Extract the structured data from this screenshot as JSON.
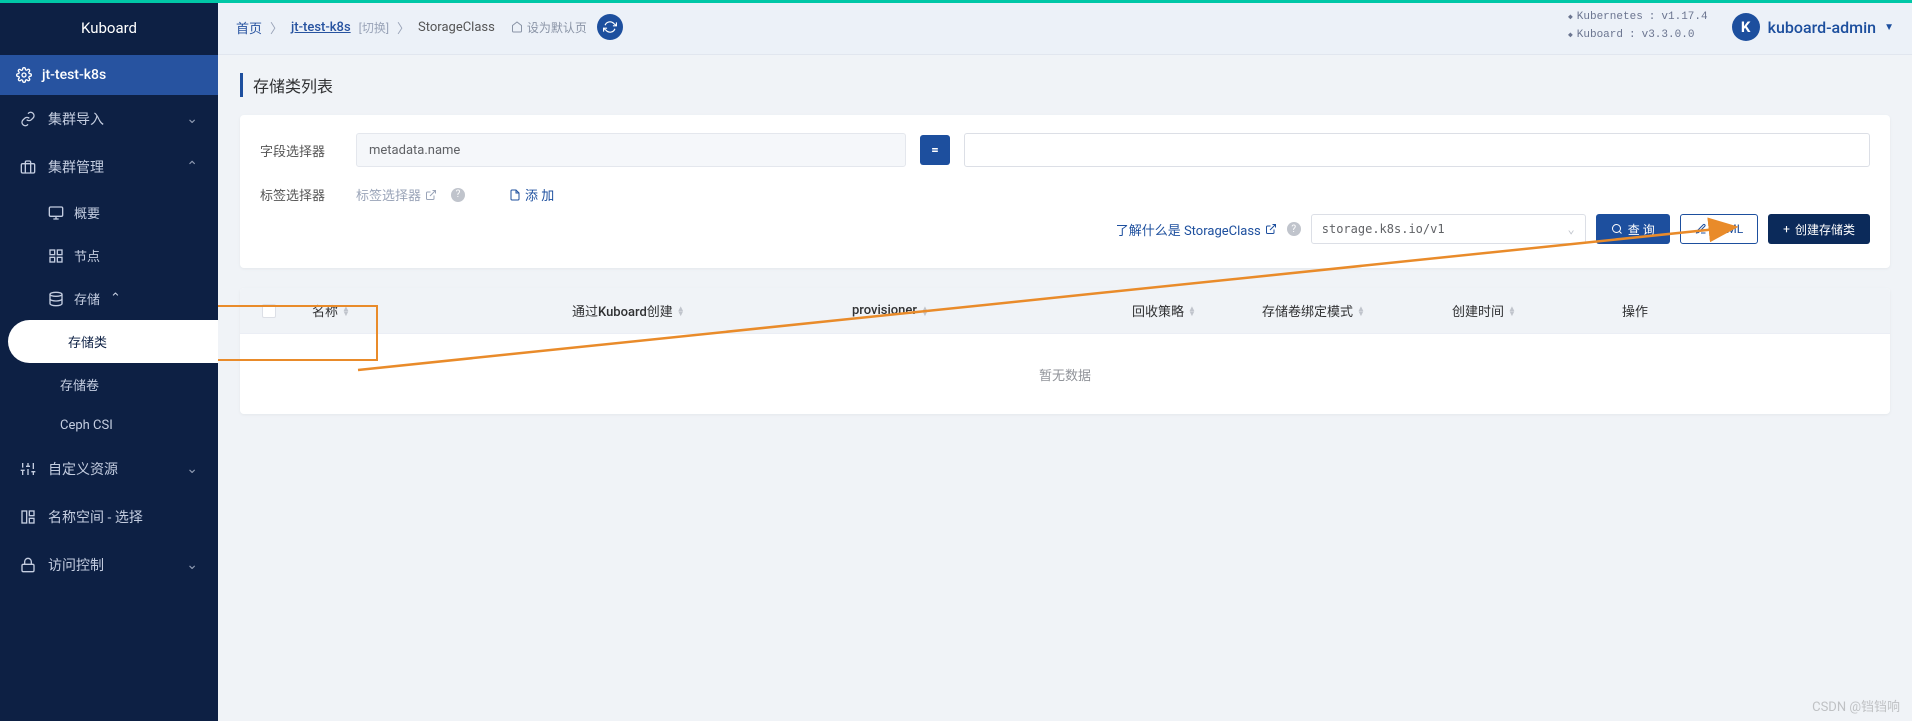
{
  "brand": "Kuboard",
  "cluster": "jt-test-k8s",
  "sidebar": {
    "import": "集群导入",
    "manage": "集群管理",
    "overview": "概要",
    "nodes": "节点",
    "storage": "存储",
    "storageClass": "存储类",
    "storageVolume": "存储卷",
    "cephCsi": "Ceph CSI",
    "crd": "自定义资源",
    "namespace": "名称空间 - 选择",
    "access": "访问控制"
  },
  "crumbs": {
    "home": "首页",
    "cluster": "jt-test-k8s",
    "switch": "[切换]",
    "page": "StorageClass",
    "setDefault": "设为默认页"
  },
  "versions": {
    "k8sLabel": "Kubernetes",
    "k8sVer": "v1.17.4",
    "kbLabel": "Kuboard",
    "kbVer": "v3.3.0.0"
  },
  "user": {
    "name": "kuboard-admin",
    "initial": "K"
  },
  "page": {
    "title": "存储类列表",
    "fieldSelectorLabel": "字段选择器",
    "fieldSelectorValue": "metadata.name",
    "labelSelectorLabel": "标签选择器",
    "labelSelectorPlaceholder": "标签选择器",
    "addLabel": "添 加",
    "learnLink": "了解什么是 StorageClass",
    "apiVersion": "storage.k8s.io/v1",
    "queryBtn": "查 询",
    "yamlBtn": "YAML",
    "createBtn": "创建存储类"
  },
  "table": {
    "cols": {
      "name": "名称",
      "viaKuboard": "通过Kuboard创建",
      "provisioner": "provisioner",
      "reclaim": "回收策略",
      "bindMode": "存储卷绑定模式",
      "created": "创建时间",
      "ops": "操作"
    },
    "empty": "暂无数据"
  },
  "watermark": "CSDN @铛铛响"
}
